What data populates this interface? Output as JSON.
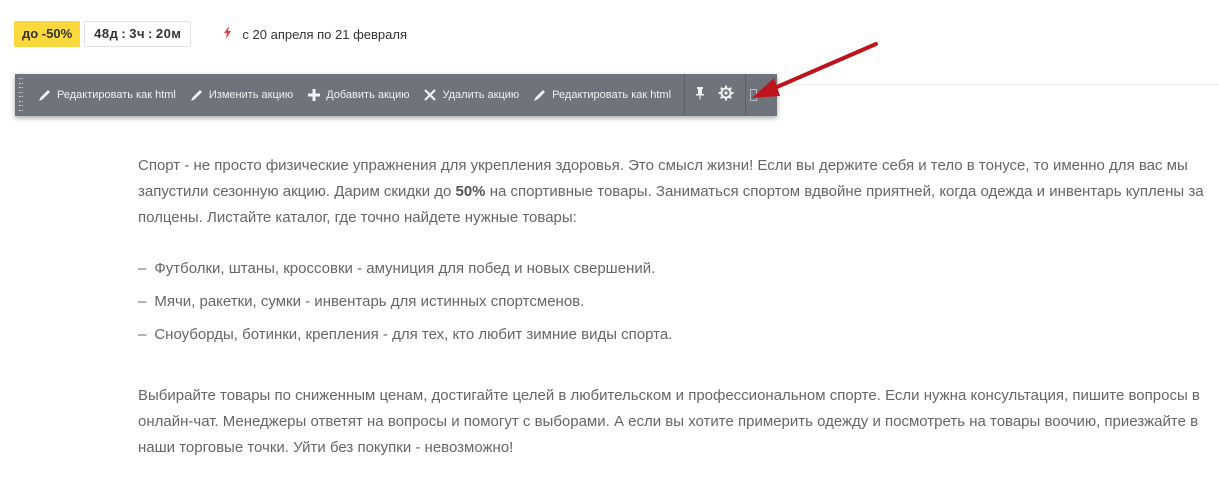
{
  "promo": {
    "discount_label": "до -50%",
    "timer": {
      "days": "48д",
      "hours": "3ч",
      "minutes": "20м",
      "separator": ":"
    },
    "period_text": "с 20 апреля по 21 февраля",
    "bolt_icon": "lightning-icon"
  },
  "toolbar": {
    "buttons": [
      {
        "label": "Редактировать как html",
        "icon": "pencil-icon"
      },
      {
        "label": "Изменить акцию",
        "icon": "pencil-icon"
      },
      {
        "label": "Добавить акцию",
        "icon": "plus-icon"
      },
      {
        "label": "Удалить акцию",
        "icon": "close-icon"
      },
      {
        "label": "Редактировать как html",
        "icon": "pencil-icon"
      }
    ],
    "pin_icon": "pin-icon",
    "settings_icon": "gear-icon"
  },
  "article": {
    "intro_before": "Спорт - не просто физические упражнения для укрепления здоровья. Это смысл жизни! Если вы держите себя и тело в тонусе, то именно для вас мы запустили сезонную акцию. Дарим скидки до ",
    "intro_bold": "50%",
    "intro_after": " на спортивные товары. Заниматься спортом вдвойне приятней, когда одежда и инвентарь куплены за полцены. Листайте каталог, где точно найдете нужные товары:",
    "list_dash": "–",
    "list": [
      "Футболки, штаны, кроссовки - амуниция для побед и новых свершений.",
      "Мячи, ракетки, сумки - инвентарь для истинных спортсменов.",
      "Сноуборды, ботинки, крепления - для тех, кто любит зимние виды спорта."
    ],
    "outro": "Выбирайте товары по сниженным ценам, достигайте целей в любительском и профессиональном спорте. Если нужна консультация, пишите вопросы в онлайн-чат. Менеджеры ответят на вопросы и помогут с выборами. А если вы хотите примерить одежду и посмотреть на товары воочию, приезжайте в наши торговые точки. Уйти без покупки - невозможно!"
  },
  "colors": {
    "badge": "#f9d93b",
    "toolbar": "#6e737c",
    "arrow": "#c0141c",
    "bolt": "#e23b3b"
  }
}
